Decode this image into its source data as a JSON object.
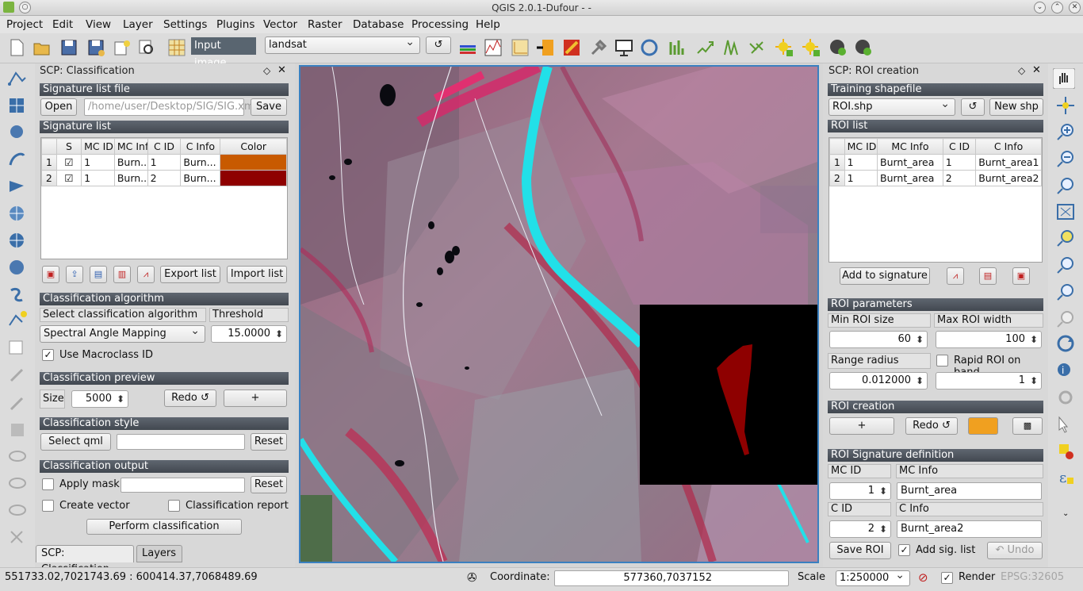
{
  "window": {
    "title": "QGIS 2.0.1-Dufour - -"
  },
  "menu": [
    "Project",
    "Edit",
    "View",
    "Layer",
    "Settings",
    "Plugins",
    "Vector",
    "Raster",
    "Database",
    "Processing",
    "Help"
  ],
  "toolbar": {
    "input_image_label": "Input image",
    "input_image_value": "landsat"
  },
  "classification_panel": {
    "title": "SCP: Classification",
    "signature_file_header": "Signature list file",
    "open_label": "Open",
    "file_path_placeholder": "/home/user/Desktop/SIG/SIG.xml",
    "save_label": "Save",
    "signature_list_header": "Signature list",
    "columns": [
      "S",
      "MC ID",
      "MC Info",
      "C ID",
      "C Info",
      "Color"
    ],
    "rows": [
      {
        "n": "1",
        "mc_id": "1",
        "mc_info": "Burn...",
        "c_id": "1",
        "c_info": "Burn...",
        "color": "#c85a00"
      },
      {
        "n": "2",
        "mc_id": "1",
        "mc_info": "Burn...",
        "c_id": "2",
        "c_info": "Burn...",
        "color": "#8e0000"
      }
    ],
    "export_label": "Export list",
    "import_label": "Import list",
    "algorithm_header": "Classification algorithm",
    "select_algorithm_label": "Select classification algorithm",
    "threshold_label": "Threshold",
    "algorithm_value": "Spectral Angle Mapping",
    "threshold_value": "15.0000",
    "macroclass_label": "Use Macroclass ID",
    "preview_header": "Classification preview",
    "size_label": "Size",
    "size_value": "5000",
    "redo_label": "Redo ↺",
    "plus_label": "+",
    "style_header": "Classification style",
    "select_qml_label": "Select qml",
    "reset_label": "Reset",
    "output_header": "Classification output",
    "apply_mask_label": "Apply mask",
    "create_vector_label": "Create vector",
    "report_label": "Classification report",
    "perform_label": "Perform classification",
    "tab_classification": "SCP: Classification",
    "tab_layers": "Layers"
  },
  "roi_panel": {
    "title": "SCP: ROI creation",
    "training_header": "Training shapefile",
    "shapefile_value": "ROI.shp",
    "new_shp_label": "New shp",
    "roi_list_header": "ROI list",
    "columns": [
      "MC ID",
      "MC Info",
      "C ID",
      "C Info"
    ],
    "rows": [
      {
        "n": "1",
        "mc_id": "1",
        "mc_info": "Burnt_area",
        "c_id": "1",
        "c_info": "Burnt_area1"
      },
      {
        "n": "2",
        "mc_id": "1",
        "mc_info": "Burnt_area",
        "c_id": "2",
        "c_info": "Burnt_area2"
      }
    ],
    "add_signature_label": "Add to signature",
    "params_header": "ROI parameters",
    "min_roi_label": "Min ROI size",
    "max_roi_label": "Max ROI width",
    "min_roi_value": "60",
    "max_roi_value": "100",
    "range_radius_label": "Range radius",
    "rapid_roi_label": "Rapid ROI on band",
    "range_radius_value": "0.012000",
    "band_value": "1",
    "creation_header": "ROI creation",
    "plus_label": "+",
    "redo_label": "Redo ↺",
    "sigdef_header": "ROI Signature definition",
    "mc_id_label": "MC ID",
    "mc_info_label": "MC Info",
    "mc_id_value": "1",
    "mc_info_value": "Burnt_area",
    "c_id_label": "C ID",
    "c_info_label": "C Info",
    "c_id_value": "2",
    "c_info_value": "Burnt_area2",
    "save_roi_label": "Save ROI",
    "add_sig_label": "Add sig. list",
    "undo_label": "↶ Undo"
  },
  "status": {
    "extent": "551733.02,7021743.69 : 600414.37,7068489.69",
    "coordinate_label": "Coordinate:",
    "coordinate_value": "577360,7037152",
    "scale_label": "Scale",
    "scale_value": "1:250000",
    "render_label": "Render",
    "crs": "EPSG:32605"
  },
  "colors": {
    "accent": "#3a80c0",
    "section_header": "#4a5058",
    "river": "#22e0e8",
    "burn": "#8e0000"
  }
}
